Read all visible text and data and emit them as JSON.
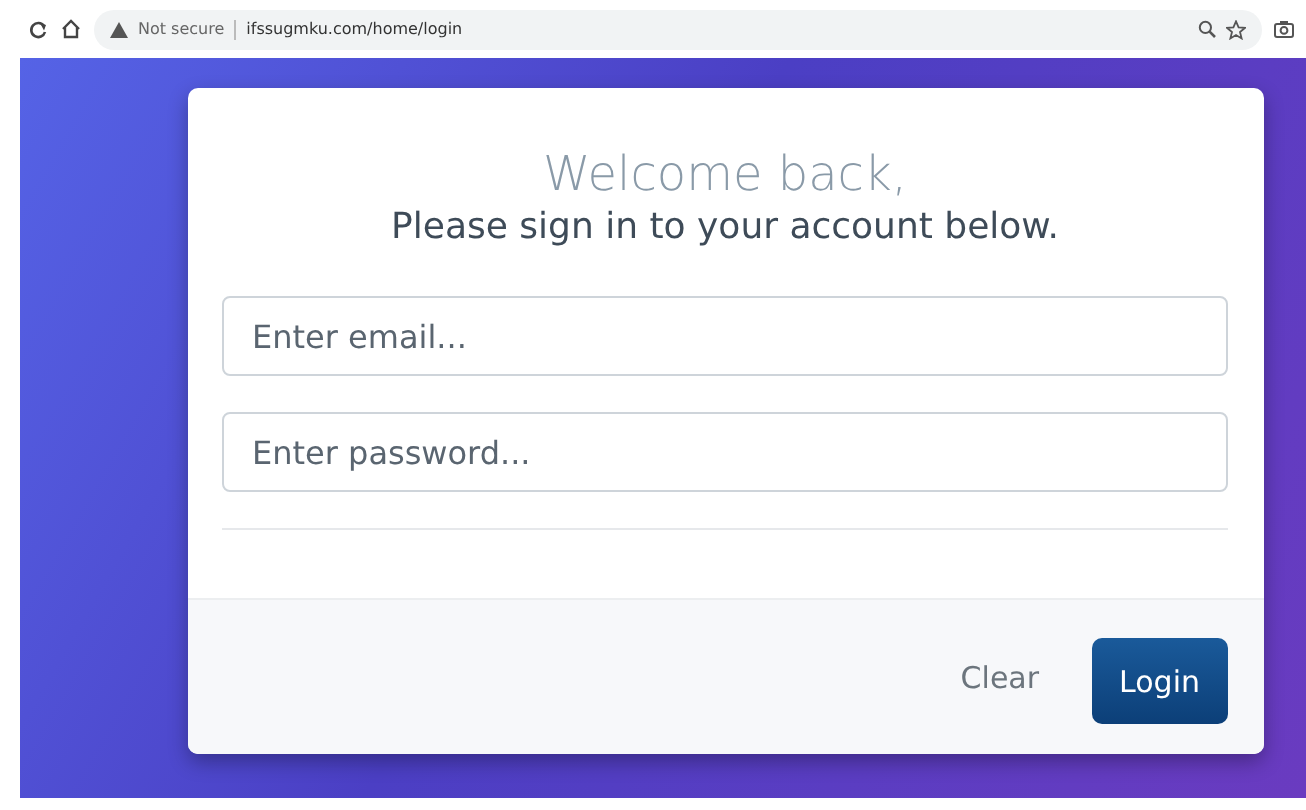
{
  "browser": {
    "security": "Not secure",
    "url": "ifssugmku.com/home/login"
  },
  "card": {
    "title": "Welcome back,",
    "subtitle": "Please sign in to your account below.",
    "fields": [
      {
        "placeholder": "Enter email..."
      },
      {
        "placeholder": "Enter password..."
      }
    ],
    "buttons": [
      {
        "label": "Clear",
        "kind": "link"
      },
      {
        "label": "Login",
        "kind": "primary"
      }
    ]
  }
}
